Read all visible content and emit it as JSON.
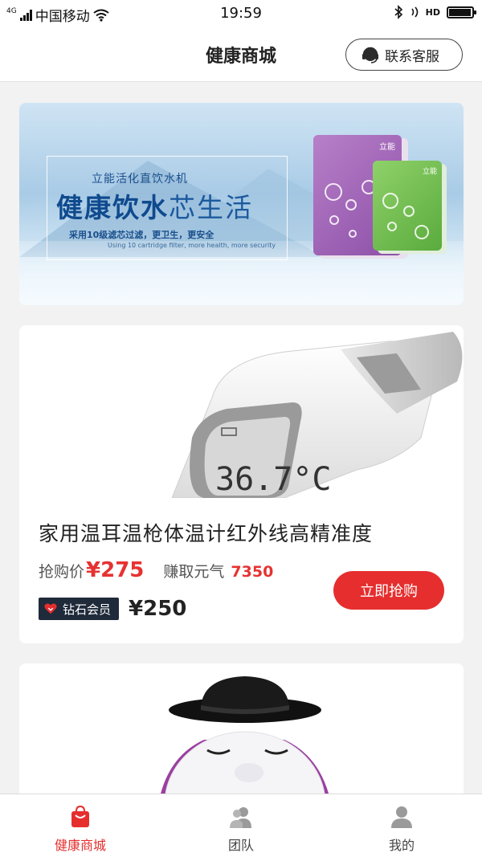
{
  "status_bar": {
    "network_badge": "4G",
    "carrier": "中国移动",
    "time": "19:59",
    "hd_label": "HD",
    "battery_level": 0.95
  },
  "header": {
    "title": "健康商城",
    "service_button": "联系客服"
  },
  "banner": {
    "subtitle": "立能活化直饮水机",
    "headline_bold": "健康饮水",
    "headline_light": "芯生活",
    "line1": "采用10级滤芯过滤，更卫生，更安全",
    "line2": "Using 10 cartridge filter, more health, more security",
    "brand_purple": "立能",
    "brand_green": "立能"
  },
  "products": [
    {
      "name": "家用温耳温枪体温计红外线高精准度",
      "price_label": "抢购价",
      "price": "¥275",
      "earn_label": "赚取元气",
      "earn_value": "7350",
      "vip_label": "钻石会员",
      "vip_price": "¥250",
      "buy_button": "立即抢购",
      "display_reading": "36.7°C"
    }
  ],
  "tabbar": {
    "items": [
      {
        "label": "健康商城",
        "icon": "shopping-bag-icon",
        "active": true
      },
      {
        "label": "团队",
        "icon": "team-icon",
        "active": false
      },
      {
        "label": "我的",
        "icon": "user-icon",
        "active": false
      }
    ]
  },
  "colors": {
    "accent": "#e62e2e",
    "vip_badge_bg": "#1f2a3a",
    "background": "#f2f2f2"
  }
}
